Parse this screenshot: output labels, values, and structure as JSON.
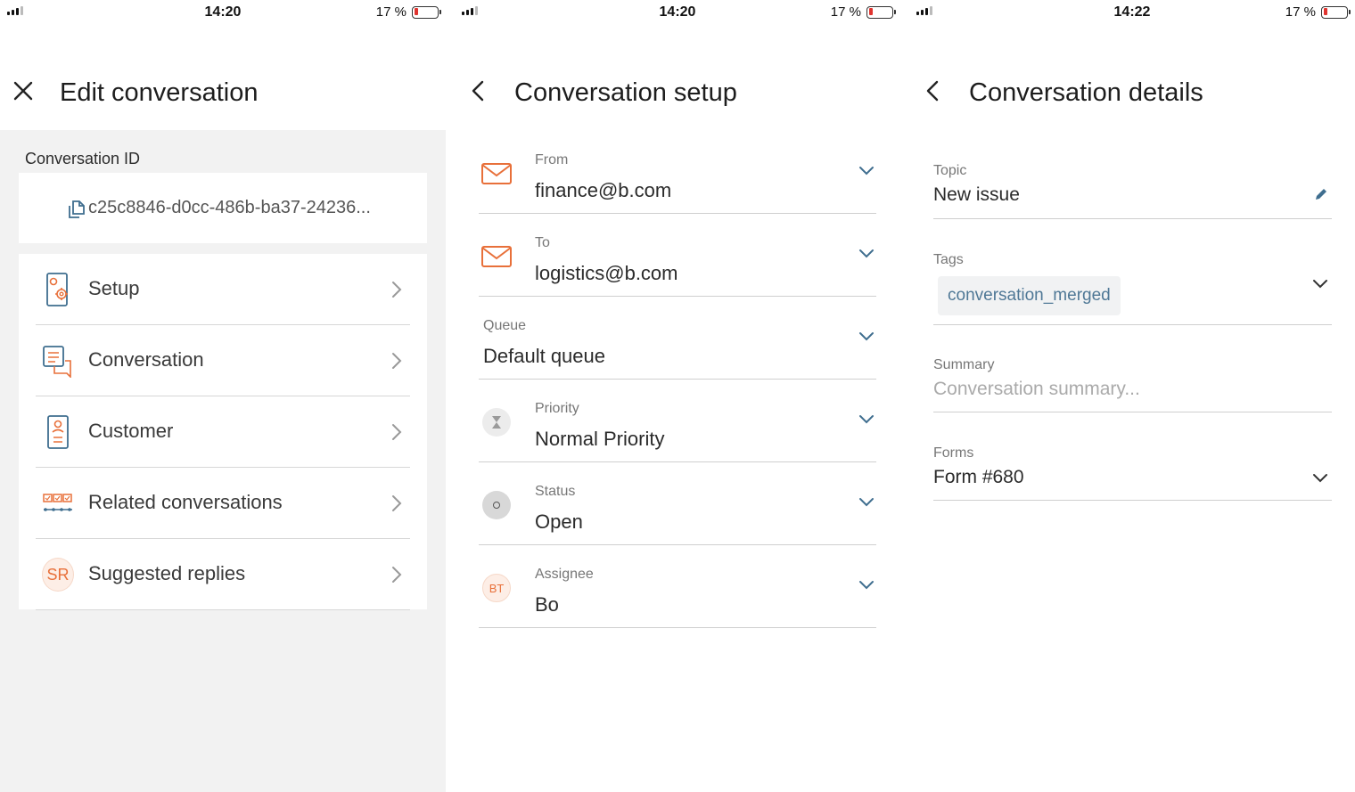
{
  "status_bars": [
    {
      "time": "14:20",
      "battery": "17 %",
      "battery_level": 0.17
    },
    {
      "time": "14:20",
      "battery": "17 %",
      "battery_level": 0.17
    },
    {
      "time": "14:22",
      "battery": "17 %",
      "battery_level": 0.17
    }
  ],
  "edit": {
    "title": "Edit conversation",
    "id_label": "Conversation ID",
    "id_value": "c25c8846-d0cc-486b-ba37-24236...",
    "menu": [
      {
        "label": "Setup"
      },
      {
        "label": "Conversation"
      },
      {
        "label": "Customer"
      },
      {
        "label": "Related conversations"
      },
      {
        "label": "Suggested replies",
        "badge": "SR"
      }
    ]
  },
  "setup": {
    "title": "Conversation setup",
    "rows": [
      {
        "label": "From",
        "value": "finance@b.com"
      },
      {
        "label": "To",
        "value": "logistics@b.com"
      },
      {
        "label": "Queue",
        "value": "Default queue"
      },
      {
        "label": "Priority",
        "value": "Normal Priority"
      },
      {
        "label": "Status",
        "value": "Open"
      },
      {
        "label": "Assignee",
        "value": "Bo",
        "badge": "BT"
      }
    ]
  },
  "details": {
    "title": "Conversation details",
    "topic_label": "Topic",
    "topic_value": "New issue",
    "tags_label": "Tags",
    "tag": "conversation_merged",
    "summary_label": "Summary",
    "summary_placeholder": "Conversation summary...",
    "forms_label": "Forms",
    "forms_value": "Form #680"
  },
  "colors": {
    "accent": "#e8703a",
    "chevron": "#3f6e8f",
    "tag_text": "#4f7896",
    "battery_low": "#e0342f"
  }
}
